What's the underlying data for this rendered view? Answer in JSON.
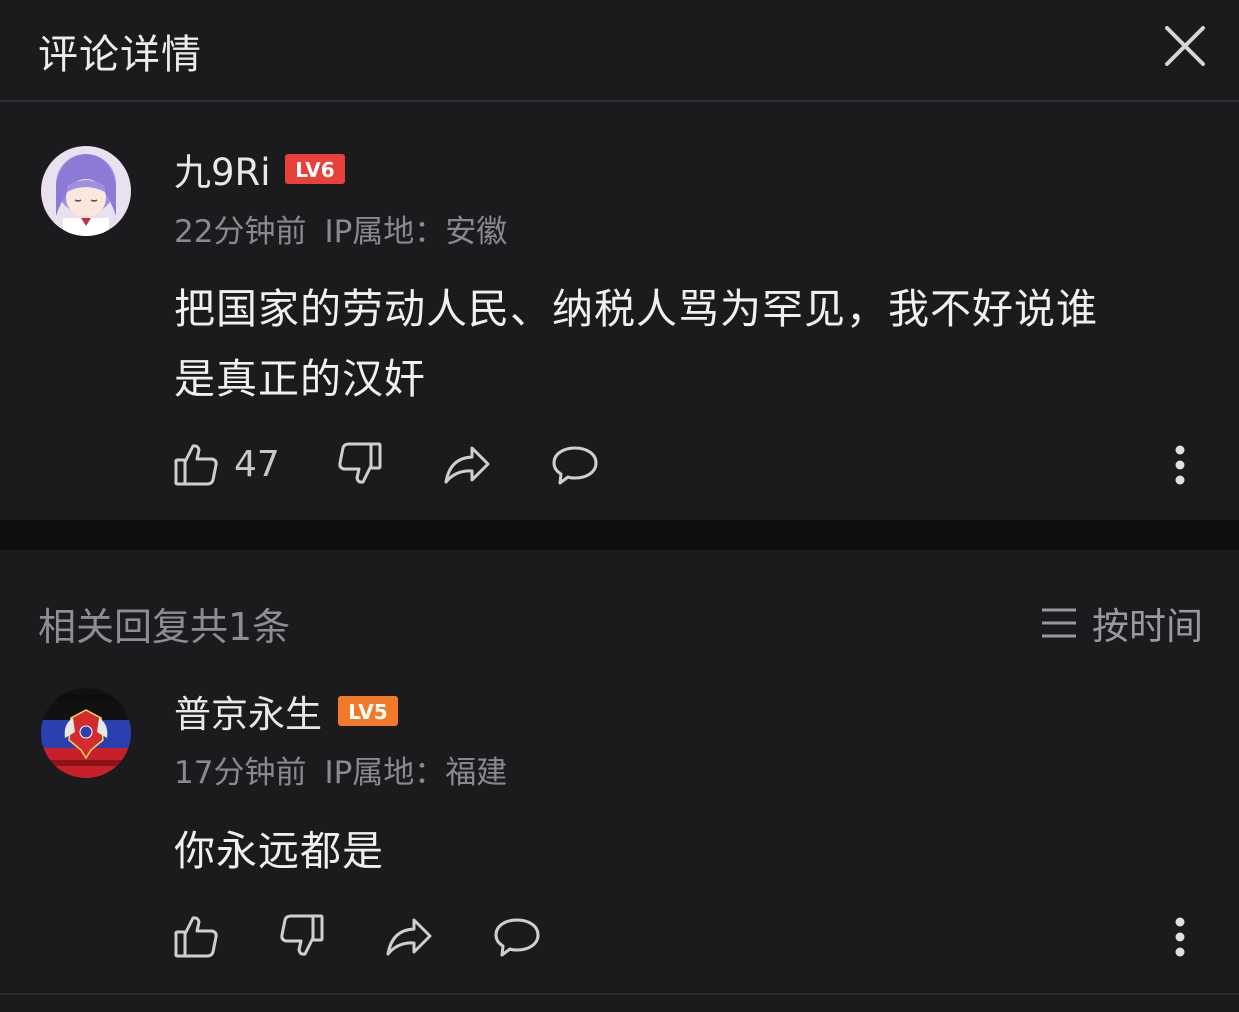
{
  "header": {
    "title": "评论详情"
  },
  "main_comment": {
    "username": "九9Ri",
    "level": "LV6",
    "time": "22分钟前",
    "ip_location": "IP属地：安徽",
    "content_line1": "把国家的劳动人民、纳税人骂为罕见，我不好说谁",
    "content_line2": "是真正的汉奸",
    "like_count": "47"
  },
  "replies": {
    "count_label": "相关回复共1条",
    "sort_label": "按时间"
  },
  "reply": {
    "username": "普京永生",
    "level": "LV5",
    "time": "17分钟前",
    "ip_location": "IP属地：福建",
    "content": "你永远都是"
  },
  "colors": {
    "background": "#1b1b1d",
    "level_badge_lv6": "#e8403a",
    "level_badge_lv5": "#f07a2a"
  }
}
